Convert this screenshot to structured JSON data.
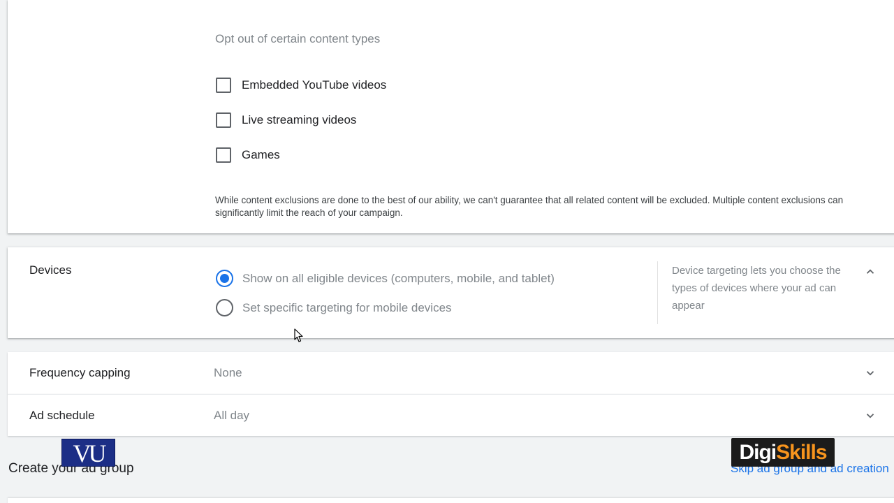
{
  "content_exclusions": {
    "heading": "Opt out of certain content types",
    "options": [
      {
        "label": "Embedded YouTube videos",
        "checked": false
      },
      {
        "label": "Live streaming videos",
        "checked": false
      },
      {
        "label": "Games",
        "checked": false
      }
    ],
    "note": "While content exclusions are done to the best of our ability, we can't guarantee that all related content will be excluded. Multiple content exclusions can significantly limit the reach of your campaign."
  },
  "devices": {
    "title": "Devices",
    "options": [
      {
        "label": "Show on all eligible devices (computers, mobile, and tablet)",
        "selected": true
      },
      {
        "label": "Set specific targeting for mobile devices",
        "selected": false
      }
    ],
    "help_text": "Device targeting lets you choose the types of devices where your ad can appear",
    "toggle_icon": "chevron-up-icon"
  },
  "frequency_capping": {
    "title": "Frequency capping",
    "value": "None",
    "toggle_icon": "chevron-down-icon"
  },
  "ad_schedule": {
    "title": "Ad schedule",
    "value": "All day",
    "toggle_icon": "chevron-down-icon"
  },
  "ad_group": {
    "title": "Create your ad group",
    "skip_link": "Skip ad group and ad creation"
  },
  "watermarks": {
    "vu_logo": "VU",
    "digiskills_part1": "Digi",
    "digiskills_part2": "Skills"
  },
  "colors": {
    "accent": "#1a73e8",
    "page_background": "#f1f3f4",
    "muted_text": "#80868b",
    "digiskills_orange": "#f7941d"
  }
}
